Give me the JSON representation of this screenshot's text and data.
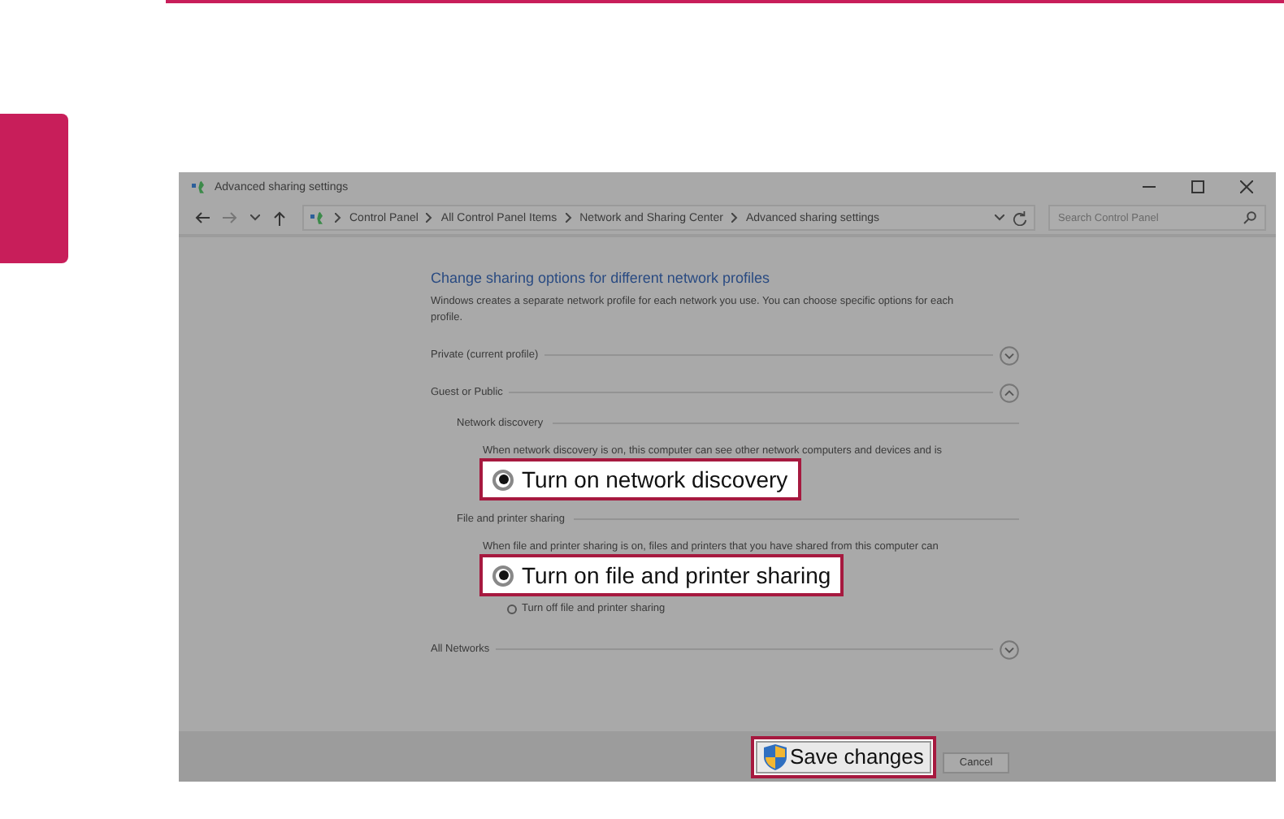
{
  "window": {
    "title": "Advanced sharing settings"
  },
  "address_bar": {
    "breadcrumb": [
      "Control Panel",
      "All Control Panel Items",
      "Network and Sharing Center",
      "Advanced sharing settings"
    ]
  },
  "search": {
    "placeholder": "Search Control Panel"
  },
  "content": {
    "heading": "Change sharing options for different network profiles",
    "description": "Windows creates a separate network profile for each network you use. You can choose specific options for each profile.",
    "profiles": [
      {
        "name": "Private (current profile)",
        "expanded": false
      },
      {
        "name": "Guest or Public",
        "expanded": true,
        "sections": [
          {
            "title": "Network discovery",
            "description": "When network discovery is on, this computer can see other network computers and devices and is",
            "options": [
              {
                "label": "Turn on network discovery",
                "selected": true,
                "highlighted": true
              }
            ]
          },
          {
            "title": "File and printer sharing",
            "description": "When file and printer sharing is on, files and printers that you have shared from this computer can",
            "options": [
              {
                "label": "Turn on file and printer sharing",
                "selected": true,
                "highlighted": true
              },
              {
                "label": "Turn off file and printer sharing",
                "selected": false,
                "highlighted": false
              }
            ]
          }
        ]
      },
      {
        "name": "All Networks",
        "expanded": false
      }
    ]
  },
  "buttons": [
    {
      "label": "Save changes",
      "kind": "shield",
      "highlighted": true
    },
    {
      "label": "Cancel",
      "kind": "plain",
      "highlighted": false
    }
  ]
}
